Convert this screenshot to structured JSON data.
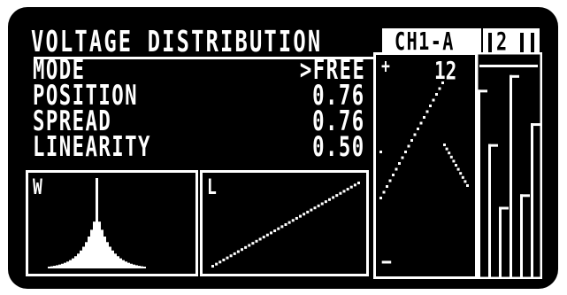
{
  "screen": {
    "title": "VOLTAGE DISTRIBUTION"
  },
  "params": [
    {
      "name": "MODE",
      "value": ">FREE"
    },
    {
      "name": "POSITION",
      "value": "0.76"
    },
    {
      "name": "SPREAD",
      "value": "0.76"
    },
    {
      "name": "LINEARITY",
      "value": "0.50"
    }
  ],
  "panels": {
    "width_label": "W",
    "linearity_label": "L"
  },
  "channel": {
    "label": "CH1-A",
    "number": "2",
    "plus_icon": "+",
    "minus_icon": "−",
    "count": "12"
  },
  "colors": {
    "background": "#000000",
    "foreground": "#ffffff",
    "frame": "#ffffff"
  },
  "levels": {
    "position": 0.76,
    "spread": 0.76,
    "linearity": 0.5,
    "channel_bars": [
      0.88,
      0.62,
      0.32,
      0.95,
      0.38,
      0.72
    ]
  }
}
